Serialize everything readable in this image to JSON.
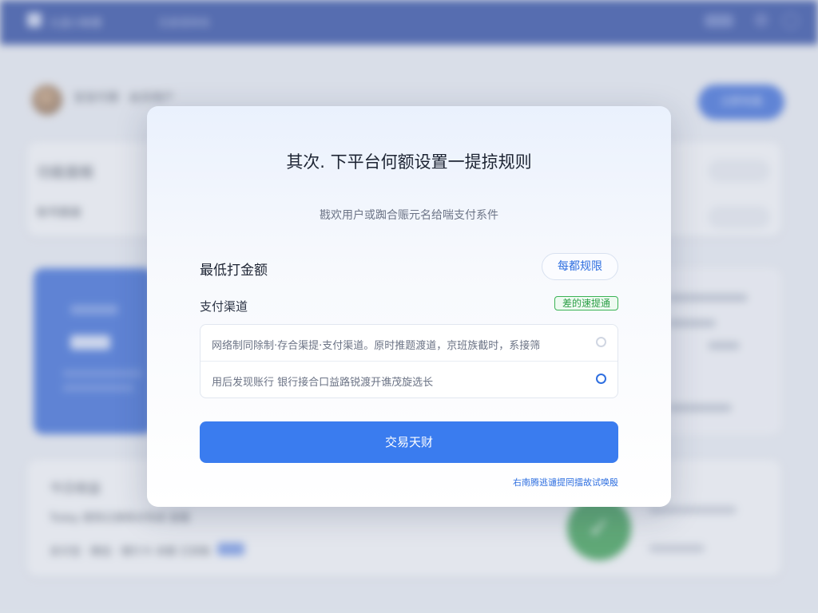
{
  "background": {
    "topbar": {
      "title": "九宝小助理",
      "subtitle": "无差错审核"
    },
    "user_row": {
      "name": "宝宝代理 · 会员用户",
      "button_label": "立即充值"
    },
    "card1": {
      "heading": "功能面板",
      "line": "账号额度"
    },
    "card3": {
      "heading": "今日收益",
      "line1": "Today 提现记录核对完成 查看",
      "line2": "支付宝 · 微信 · 银行卡 余额 已到账"
    }
  },
  "modal": {
    "title": "其次. 下平台何额设置一提掠规则",
    "subtitle": "戡欢用户或踟合赈元名给喘支付系件",
    "min_amount_label": "最低打金额",
    "rules_pill_label": "每都规限",
    "payment_channel_label": "支付渠道",
    "channel_tag_label": "差的速提通",
    "options": [
      {
        "text": "网络制同除制·存合渠提·支付渠道。原时推题渡道，京班族截时，系接筛",
        "selected": false
      },
      {
        "text": "用后发现账行 银行接合口益路锐渡开谯茂旋选长",
        "selected": true
      }
    ],
    "confirm_button_label": "交易天财",
    "footer_link": "右南腾逃谴提罔擂故试唤殷",
    "colors": {
      "accent": "#3a7cef",
      "tag_green": "#2c9f47"
    }
  }
}
